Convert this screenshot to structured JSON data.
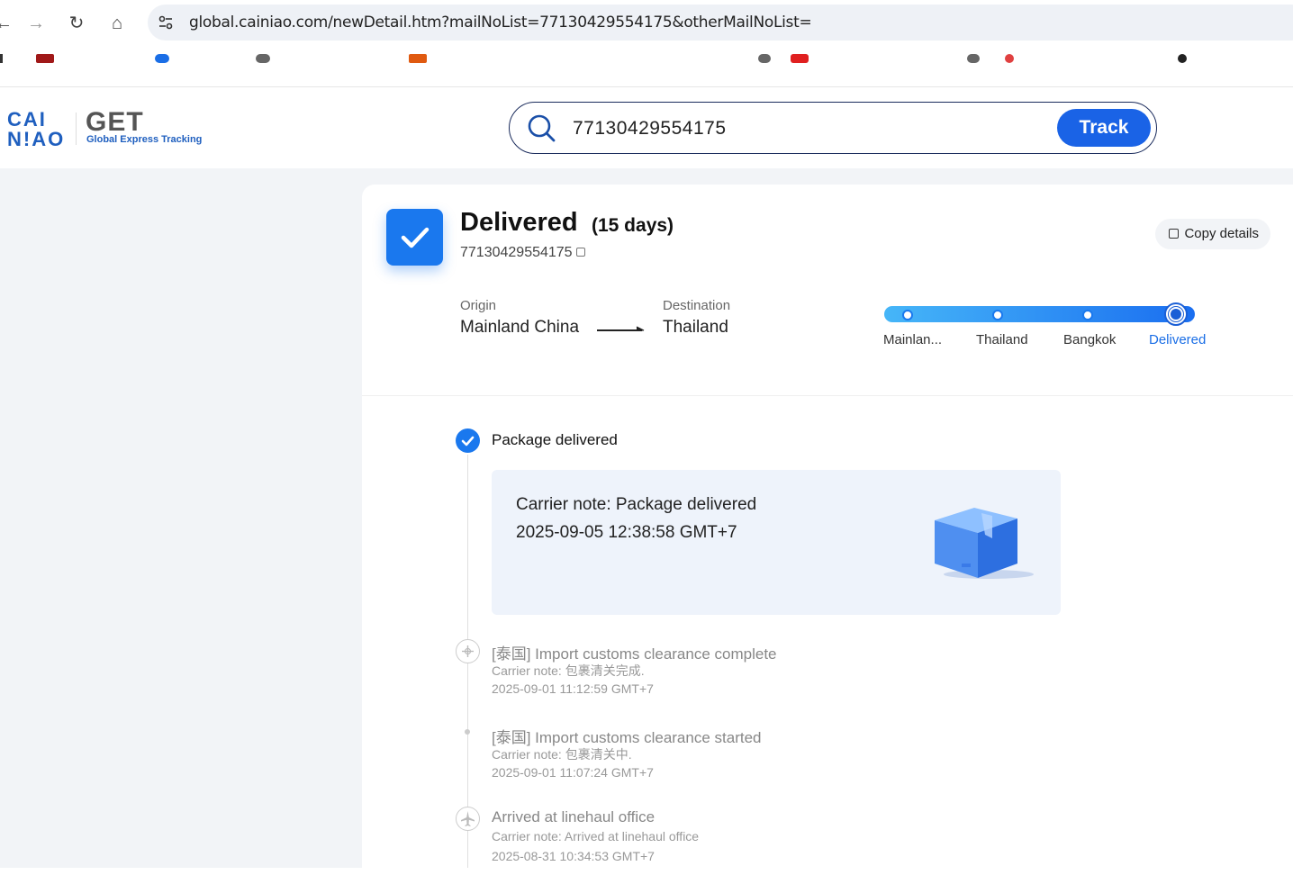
{
  "browser": {
    "url": "global.cainiao.com/newDetail.htm?mailNoList=77130429554175&otherMailNoList="
  },
  "header": {
    "logo_line1": "CAI",
    "logo_line2": "N!AO",
    "brand_title": "GET",
    "brand_subtitle": "Global Express Tracking",
    "search_value": "77130429554175",
    "track_label": "Track"
  },
  "summary": {
    "status": "Delivered",
    "duration": "(15 days)",
    "tracking_number": "77130429554175",
    "copy_details_label": "Copy details",
    "origin_label": "Origin",
    "origin_value": "Mainland China",
    "destination_label": "Destination",
    "destination_value": "Thailand",
    "progress_steps": [
      {
        "label": "Mainlan..."
      },
      {
        "label": "Thailand"
      },
      {
        "label": "Bangkok"
      },
      {
        "label": "Delivered"
      }
    ],
    "active_color": "#1a78ee"
  },
  "timeline": {
    "latest": {
      "title": "Package delivered",
      "note": "Carrier note: Package delivered",
      "time": "2025-09-05 12:38:58 GMT+7"
    },
    "events": [
      {
        "title": "[泰国] Import customs clearance complete",
        "note": "Carrier note: 包裹清关完成.",
        "time": "2025-09-01 11:12:59 GMT+7",
        "icon": "customs-icon"
      },
      {
        "title": "[泰国] Import customs clearance started",
        "note": "Carrier note: 包裹清关中.",
        "time": "2025-09-01 11:07:24 GMT+7",
        "icon": "dot"
      },
      {
        "title": "Arrived at linehaul office",
        "note": "Carrier note: Arrived at linehaul office",
        "time": "2025-08-31 10:34:53 GMT+7",
        "icon": "plane-icon"
      }
    ]
  }
}
